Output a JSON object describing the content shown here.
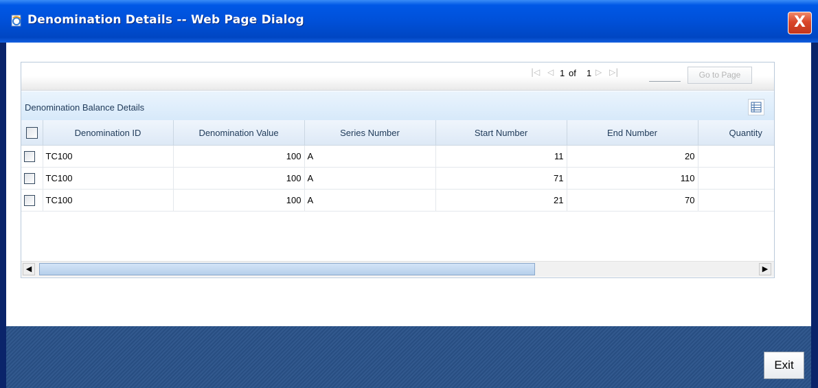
{
  "window": {
    "title": "Denomination Details -- Web Page Dialog",
    "close_label": "X"
  },
  "pager": {
    "current_page": "1",
    "of_label": "of",
    "total_pages": "1",
    "page_input_value": "",
    "goto_label": "Go to Page"
  },
  "section": {
    "title": "Denomination Balance Details"
  },
  "table": {
    "columns": [
      "Denomination ID",
      "Denomination Value",
      "Series Number",
      "Start Number",
      "End Number",
      "Quantity"
    ],
    "rows": [
      {
        "denomination_id": "TC100",
        "denomination_value": "100",
        "series_number": "A",
        "start_number": "11",
        "end_number": "20",
        "quantity": ""
      },
      {
        "denomination_id": "TC100",
        "denomination_value": "100",
        "series_number": "A",
        "start_number": "71",
        "end_number": "110",
        "quantity": ""
      },
      {
        "denomination_id": "TC100",
        "denomination_value": "100",
        "series_number": "A",
        "start_number": "21",
        "end_number": "70",
        "quantity": ""
      }
    ]
  },
  "footer": {
    "exit_label": "Exit"
  },
  "colors": {
    "title_bar": "#0050d8",
    "close_button": "#d9462a",
    "footer": "#2a5289",
    "header_blue": "#d7e9fa"
  }
}
